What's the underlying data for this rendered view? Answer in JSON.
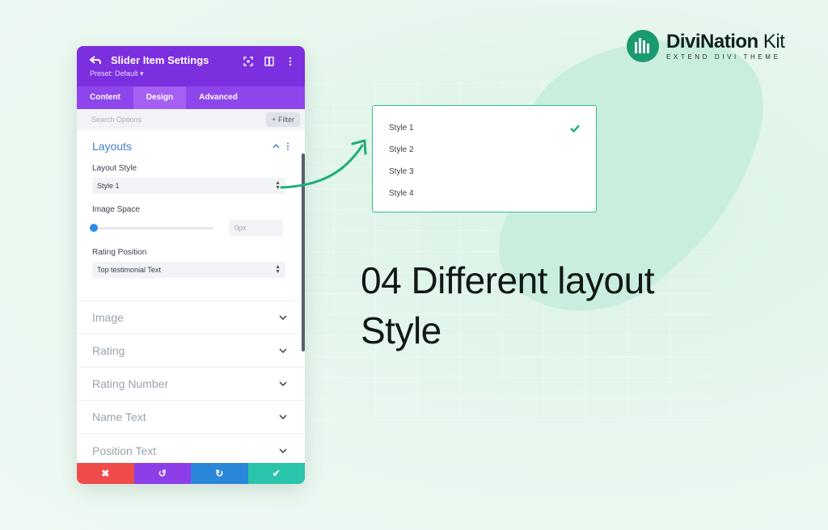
{
  "logo": {
    "name": "DiviNation",
    "name_suffix": "Kit",
    "tagline": "EXTEND DIVI THEME",
    "color": "#1a9b6f"
  },
  "panel": {
    "title": "Slider Item Settings",
    "preset": "Preset: Default ▾",
    "header_color": "#7b2fde",
    "tabs": [
      {
        "label": "Content",
        "active": false
      },
      {
        "label": "Design",
        "active": true
      },
      {
        "label": "Advanced",
        "active": false
      }
    ],
    "search_placeholder": "Search Options",
    "filter_label": "+ Filter",
    "layouts": {
      "title": "Layouts",
      "layout_style_label": "Layout Style",
      "layout_style_value": "Style 1",
      "image_space_label": "Image Space",
      "image_space_value": "0px",
      "rating_position_label": "Rating Position",
      "rating_position_value": "Top testimonial Text"
    },
    "collapsed_sections": [
      "Image",
      "Rating",
      "Rating Number",
      "Name Text",
      "Position Text"
    ],
    "bottom_buttons": [
      {
        "name": "cancel",
        "glyph": "✖",
        "color": "#ef4b4b"
      },
      {
        "name": "undo",
        "glyph": "↺",
        "color": "#8d3ee8"
      },
      {
        "name": "redo",
        "glyph": "↻",
        "color": "#2b87da"
      },
      {
        "name": "save",
        "glyph": "✔",
        "color": "#29c4a9"
      }
    ]
  },
  "dropdown": {
    "options": [
      "Style 1",
      "Style 2",
      "Style 3",
      "Style 4"
    ],
    "selected_index": 0
  },
  "headline": {
    "line1": "04 Different layout",
    "line2": "Style"
  }
}
